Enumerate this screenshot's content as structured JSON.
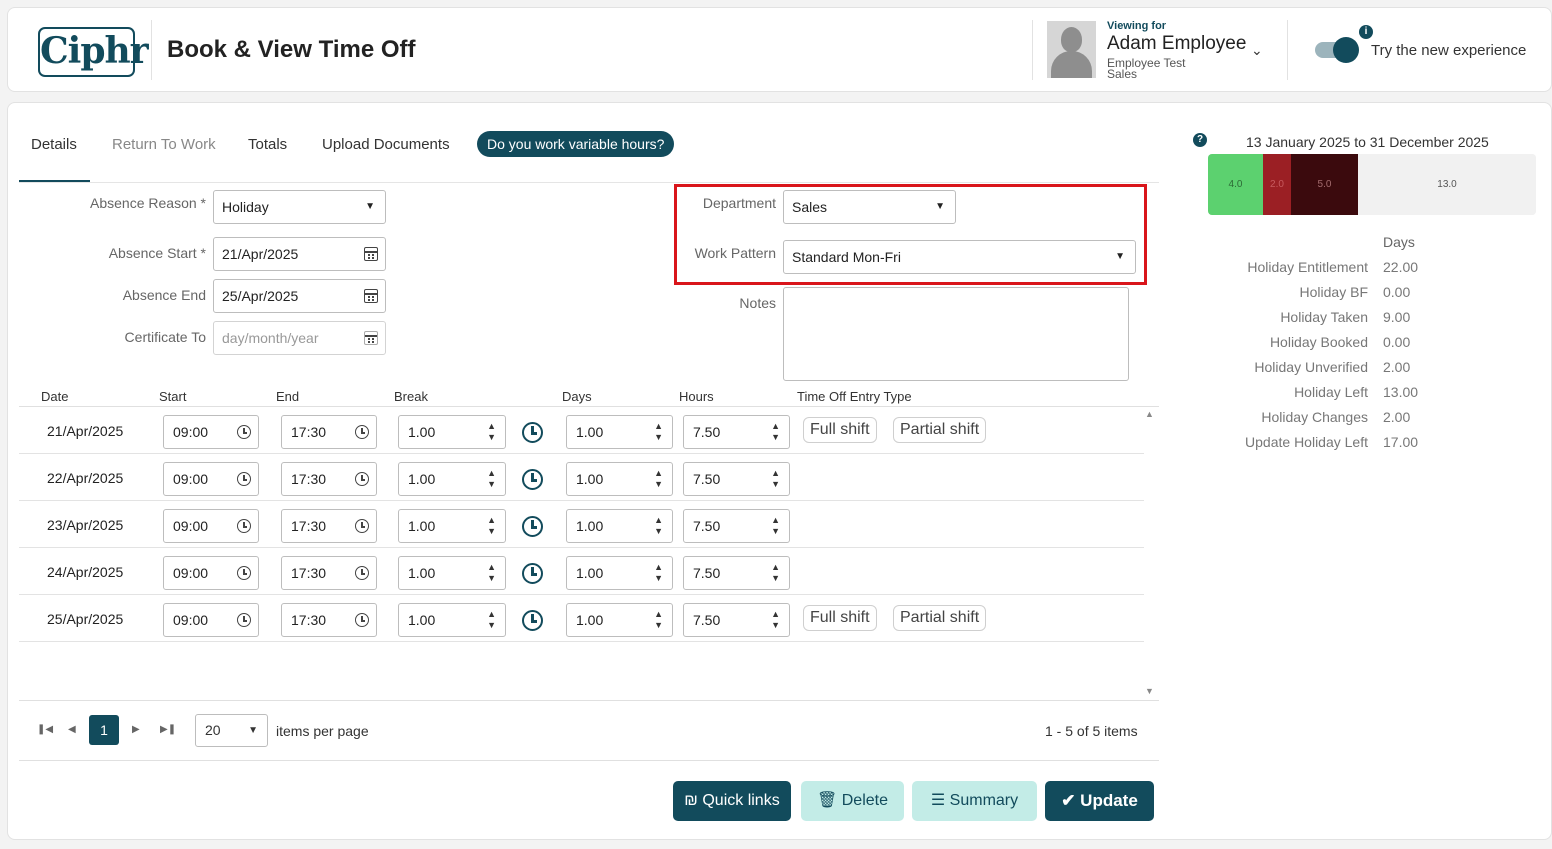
{
  "header": {
    "logo": "Ciphr",
    "title": "Book & View Time Off",
    "viewing_for": "Viewing for",
    "employee_name": "Adam Employee",
    "employee_sub1": "Employee Test",
    "employee_sub2": "Sales",
    "try_new": "Try the new experience",
    "info": "i"
  },
  "tabs": [
    "Details",
    "Return To Work",
    "Totals",
    "Upload Documents"
  ],
  "variable_hours_button": "Do you work variable hours?",
  "form": {
    "absence_reason_label": "Absence Reason",
    "absence_reason_value": "Holiday",
    "absence_start_label": "Absence Start",
    "absence_start_value": "21/Apr/2025",
    "absence_end_label": "Absence End",
    "absence_end_value": "25/Apr/2025",
    "certificate_to_label": "Certificate To",
    "certificate_to_placeholder": "day/month/year",
    "department_label": "Department",
    "department_value": "Sales",
    "work_pattern_label": "Work Pattern",
    "work_pattern_value": "Standard Mon-Fri",
    "notes_label": "Notes",
    "required_mark": "*"
  },
  "grid": {
    "columns": [
      "Date",
      "Start",
      "End",
      "Break",
      "Days",
      "Hours",
      "Time Off Entry Type"
    ],
    "rows": [
      {
        "date": "21/Apr/2025",
        "start": "09:00",
        "end": "17:30",
        "break": "1.00",
        "days": "1.00",
        "hours": "7.50",
        "full": "Full shift",
        "partial": "Partial shift"
      },
      {
        "date": "22/Apr/2025",
        "start": "09:00",
        "end": "17:30",
        "break": "1.00",
        "days": "1.00",
        "hours": "7.50"
      },
      {
        "date": "23/Apr/2025",
        "start": "09:00",
        "end": "17:30",
        "break": "1.00",
        "days": "1.00",
        "hours": "7.50"
      },
      {
        "date": "24/Apr/2025",
        "start": "09:00",
        "end": "17:30",
        "break": "1.00",
        "days": "1.00",
        "hours": "7.50"
      },
      {
        "date": "25/Apr/2025",
        "start": "09:00",
        "end": "17:30",
        "break": "1.00",
        "days": "1.00",
        "hours": "7.50",
        "full": "Full shift",
        "partial": "Partial shift"
      }
    ]
  },
  "pager": {
    "current_page": "1",
    "page_size": "20",
    "items_per_page_label": "items per page",
    "items_count": "1 - 5 of 5 items"
  },
  "actions": {
    "quick_links": "Quick links",
    "delete": "Delete",
    "summary": "Summary",
    "update": "Update"
  },
  "summary_panel": {
    "help": "?",
    "period": "13 January 2025 to 31 December 2025",
    "bar_segments": [
      {
        "value": "4.0",
        "color": "#5cd16f",
        "text_color": "#2d6b36"
      },
      {
        "value": "2.0",
        "color": "#9b1f24",
        "text_color": "#c75a5e"
      },
      {
        "value": "5.0",
        "color": "#3b0a0d",
        "text_color": "#a36b6d"
      },
      {
        "value": "13.0",
        "color": "#f1f1f1",
        "text_color": "#555555"
      }
    ],
    "days_header": "Days",
    "rows": [
      {
        "label": "Holiday Entitlement",
        "value": "22.00"
      },
      {
        "label": "Holiday BF",
        "value": "0.00"
      },
      {
        "label": "Holiday Taken",
        "value": "9.00"
      },
      {
        "label": "Holiday Booked",
        "value": "0.00"
      },
      {
        "label": "Holiday Unverified",
        "value": "2.00"
      },
      {
        "label": "Holiday Left",
        "value": "13.00"
      },
      {
        "label": "Holiday Changes",
        "value": "2.00"
      },
      {
        "label": "Update Holiday Left",
        "value": "17.00"
      }
    ]
  },
  "colors": {
    "brand": "#124b5c",
    "action_light": "#c3ece7",
    "highlight_box": "#d9151b"
  }
}
